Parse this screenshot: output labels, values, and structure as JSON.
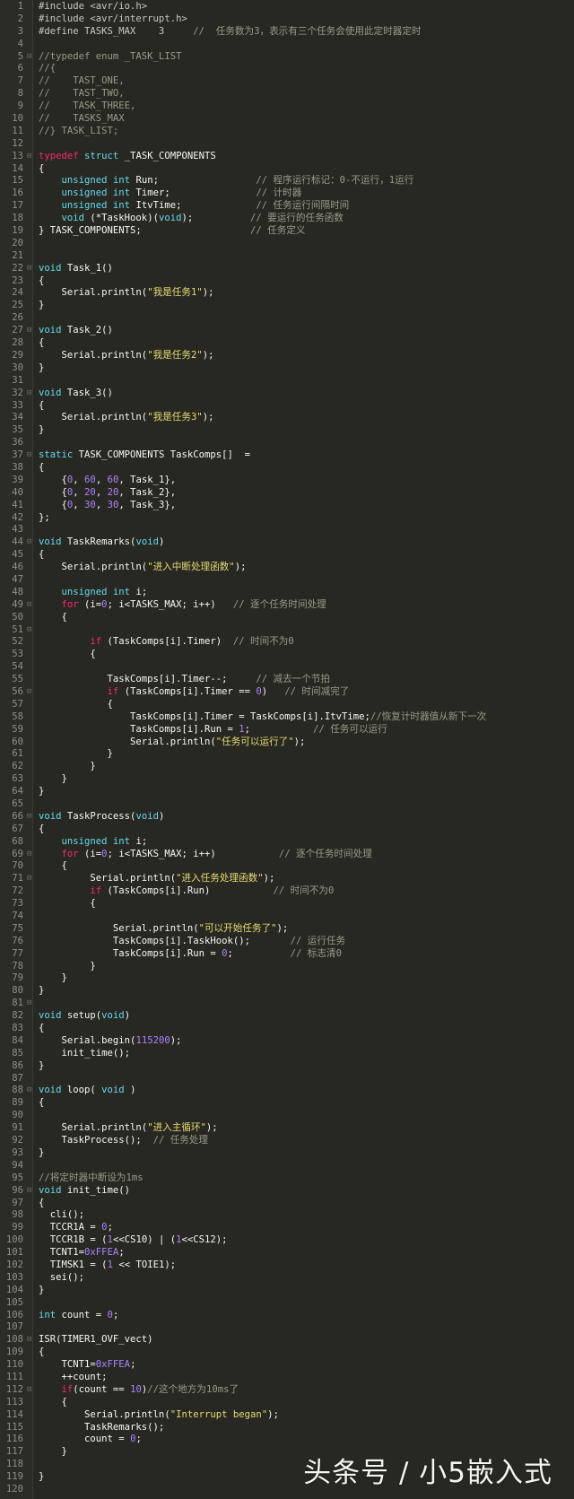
{
  "theme": {
    "background": "#272822",
    "gutter": "#2b2c26",
    "keyword": "#f92672",
    "type": "#66d9ef",
    "string": "#e6db74",
    "number": "#ae81ff",
    "comment": "#9a9a8a"
  },
  "watermark": "头条号 / 小5嵌入式",
  "lines": [
    [
      [
        "pp",
        "#include <avr/io.h>"
      ]
    ],
    [
      [
        "pp",
        "#include <avr/interrupt.h>"
      ]
    ],
    [
      [
        "pp",
        "#define TASKS_MAX    3     "
      ],
      [
        "cm",
        "//  任务数为3，表示有三个任务会使用此定时器定时"
      ]
    ],
    [],
    [
      [
        "cm",
        "//typedef enum _TASK_LIST"
      ]
    ],
    [
      [
        "cm",
        "//{"
      ]
    ],
    [
      [
        "cm",
        "//    TAST_ONE,"
      ]
    ],
    [
      [
        "cm",
        "//    TAST_TWO,"
      ]
    ],
    [
      [
        "cm",
        "//    TASK_THREE,"
      ]
    ],
    [
      [
        "cm",
        "//    TASKS_MAX"
      ]
    ],
    [
      [
        "cm",
        "//} TASK_LIST;"
      ]
    ],
    [],
    [
      [
        "kw",
        "typedef"
      ],
      [
        "plain",
        " "
      ],
      [
        "type",
        "struct"
      ],
      [
        "plain",
        " _TASK_COMPONENTS"
      ]
    ],
    [
      [
        "plain",
        "{"
      ]
    ],
    [
      [
        "plain",
        "    "
      ],
      [
        "type",
        "unsigned int"
      ],
      [
        "plain",
        " Run;                 "
      ],
      [
        "cm",
        "// 程序运行标记：0-不运行，1运行"
      ]
    ],
    [
      [
        "plain",
        "    "
      ],
      [
        "type",
        "unsigned int"
      ],
      [
        "plain",
        " Timer;               "
      ],
      [
        "cm",
        "// 计时器"
      ]
    ],
    [
      [
        "plain",
        "    "
      ],
      [
        "type",
        "unsigned int"
      ],
      [
        "plain",
        " ItvTime;             "
      ],
      [
        "cm",
        "// 任务运行间隔时间"
      ]
    ],
    [
      [
        "plain",
        "    "
      ],
      [
        "type",
        "void"
      ],
      [
        "plain",
        " (*TaskHook)("
      ],
      [
        "type",
        "void"
      ],
      [
        "plain",
        ");          "
      ],
      [
        "cm",
        "// 要运行的任务函数"
      ]
    ],
    [
      [
        "plain",
        "} TASK_COMPONENTS;                   "
      ],
      [
        "cm",
        "// 任务定义"
      ]
    ],
    [],
    [],
    [
      [
        "type",
        "void"
      ],
      [
        "plain",
        " Task_1()"
      ]
    ],
    [
      [
        "plain",
        "{"
      ]
    ],
    [
      [
        "plain",
        "    Serial.println("
      ],
      [
        "str",
        "\"我是任务1\""
      ],
      [
        "plain",
        ");"
      ]
    ],
    [
      [
        "plain",
        "}"
      ]
    ],
    [],
    [
      [
        "type",
        "void"
      ],
      [
        "plain",
        " Task_2()"
      ]
    ],
    [
      [
        "plain",
        "{"
      ]
    ],
    [
      [
        "plain",
        "    Serial.println("
      ],
      [
        "str",
        "\"我是任务2\""
      ],
      [
        "plain",
        ");"
      ]
    ],
    [
      [
        "plain",
        "}"
      ]
    ],
    [],
    [
      [
        "type",
        "void"
      ],
      [
        "plain",
        " Task_3()"
      ]
    ],
    [
      [
        "plain",
        "{"
      ]
    ],
    [
      [
        "plain",
        "    Serial.println("
      ],
      [
        "str",
        "\"我是任务3\""
      ],
      [
        "plain",
        ");"
      ]
    ],
    [
      [
        "plain",
        "}"
      ]
    ],
    [],
    [
      [
        "type",
        "static"
      ],
      [
        "plain",
        " TASK_COMPONENTS TaskComps[]  ="
      ]
    ],
    [
      [
        "plain",
        "{"
      ]
    ],
    [
      [
        "plain",
        "    {"
      ],
      [
        "num",
        "0"
      ],
      [
        "plain",
        ", "
      ],
      [
        "num",
        "60"
      ],
      [
        "plain",
        ", "
      ],
      [
        "num",
        "60"
      ],
      [
        "plain",
        ", Task_1},"
      ]
    ],
    [
      [
        "plain",
        "    {"
      ],
      [
        "num",
        "0"
      ],
      [
        "plain",
        ", "
      ],
      [
        "num",
        "20"
      ],
      [
        "plain",
        ", "
      ],
      [
        "num",
        "20"
      ],
      [
        "plain",
        ", Task_2},"
      ]
    ],
    [
      [
        "plain",
        "    {"
      ],
      [
        "num",
        "0"
      ],
      [
        "plain",
        ", "
      ],
      [
        "num",
        "30"
      ],
      [
        "plain",
        ", "
      ],
      [
        "num",
        "30"
      ],
      [
        "plain",
        ", Task_3},"
      ]
    ],
    [
      [
        "plain",
        "};"
      ]
    ],
    [],
    [
      [
        "type",
        "void"
      ],
      [
        "plain",
        " TaskRemarks("
      ],
      [
        "type",
        "void"
      ],
      [
        "plain",
        ")"
      ]
    ],
    [
      [
        "plain",
        "{"
      ]
    ],
    [
      [
        "plain",
        "    Serial.println("
      ],
      [
        "str",
        "\"进入中断处理函数\""
      ],
      [
        "plain",
        ");"
      ]
    ],
    [],
    [
      [
        "plain",
        "    "
      ],
      [
        "type",
        "unsigned int"
      ],
      [
        "plain",
        " i;"
      ]
    ],
    [
      [
        "plain",
        "    "
      ],
      [
        "kw",
        "for"
      ],
      [
        "plain",
        " (i="
      ],
      [
        "num",
        "0"
      ],
      [
        "plain",
        "; i<TASKS_MAX; i++)   "
      ],
      [
        "cm",
        "// 逐个任务时间处理"
      ]
    ],
    [
      [
        "plain",
        "    {"
      ]
    ],
    [],
    [
      [
        "plain",
        "         "
      ],
      [
        "kw",
        "if"
      ],
      [
        "plain",
        " (TaskComps[i].Timer)  "
      ],
      [
        "cm",
        "// 时间不为0"
      ]
    ],
    [
      [
        "plain",
        "         {"
      ]
    ],
    [],
    [
      [
        "plain",
        "            TaskComps[i].Timer--;     "
      ],
      [
        "cm",
        "// 减去一个节拍"
      ]
    ],
    [
      [
        "plain",
        "            "
      ],
      [
        "kw",
        "if"
      ],
      [
        "plain",
        " (TaskComps[i].Timer == "
      ],
      [
        "num",
        "0"
      ],
      [
        "plain",
        ")   "
      ],
      [
        "cm",
        "// 时间减完了"
      ]
    ],
    [
      [
        "plain",
        "            {"
      ]
    ],
    [
      [
        "plain",
        "                TaskComps[i].Timer = TaskComps[i].ItvTime;"
      ],
      [
        "cm",
        "//恢复计时器值从新下一次"
      ]
    ],
    [
      [
        "plain",
        "                TaskComps[i].Run = "
      ],
      [
        "num",
        "1"
      ],
      [
        "plain",
        ";           "
      ],
      [
        "cm",
        "// 任务可以运行"
      ]
    ],
    [
      [
        "plain",
        "                Serial.println("
      ],
      [
        "str",
        "\"任务可以运行了\""
      ],
      [
        "plain",
        ");"
      ]
    ],
    [
      [
        "plain",
        "            }"
      ]
    ],
    [
      [
        "plain",
        "         }"
      ]
    ],
    [
      [
        "plain",
        "    }"
      ]
    ],
    [
      [
        "plain",
        "}"
      ]
    ],
    [],
    [
      [
        "type",
        "void"
      ],
      [
        "plain",
        " TaskProcess("
      ],
      [
        "type",
        "void"
      ],
      [
        "plain",
        ")"
      ]
    ],
    [
      [
        "plain",
        "{"
      ]
    ],
    [
      [
        "plain",
        "    "
      ],
      [
        "type",
        "unsigned int"
      ],
      [
        "plain",
        " i;"
      ]
    ],
    [
      [
        "plain",
        "    "
      ],
      [
        "kw",
        "for"
      ],
      [
        "plain",
        " (i="
      ],
      [
        "num",
        "0"
      ],
      [
        "plain",
        "; i<TASKS_MAX; i++)           "
      ],
      [
        "cm",
        "// 逐个任务时间处理"
      ]
    ],
    [
      [
        "plain",
        "    {"
      ]
    ],
    [
      [
        "plain",
        "         Serial.println("
      ],
      [
        "str",
        "\"进入任务处理函数\""
      ],
      [
        "plain",
        ");"
      ]
    ],
    [
      [
        "plain",
        "         "
      ],
      [
        "kw",
        "if"
      ],
      [
        "plain",
        " (TaskComps[i].Run)           "
      ],
      [
        "cm",
        "// 时间不为0"
      ]
    ],
    [
      [
        "plain",
        "         {"
      ]
    ],
    [],
    [
      [
        "plain",
        "             Serial.println("
      ],
      [
        "str",
        "\"可以开始任务了\""
      ],
      [
        "plain",
        ");"
      ]
    ],
    [
      [
        "plain",
        "             TaskComps[i].TaskHook();       "
      ],
      [
        "cm",
        "// 运行任务"
      ]
    ],
    [
      [
        "plain",
        "             TaskComps[i].Run = "
      ],
      [
        "num",
        "0"
      ],
      [
        "plain",
        ";          "
      ],
      [
        "cm",
        "// 标志清0"
      ]
    ],
    [
      [
        "plain",
        "         }"
      ]
    ],
    [
      [
        "plain",
        "    }"
      ]
    ],
    [
      [
        "plain",
        "}"
      ]
    ],
    [],
    [
      [
        "type",
        "void"
      ],
      [
        "plain",
        " setup("
      ],
      [
        "type",
        "void"
      ],
      [
        "plain",
        ")"
      ]
    ],
    [
      [
        "plain",
        "{"
      ]
    ],
    [
      [
        "plain",
        "    Serial.begin("
      ],
      [
        "num",
        "115200"
      ],
      [
        "plain",
        ");"
      ]
    ],
    [
      [
        "plain",
        "    init_time();"
      ]
    ],
    [
      [
        "plain",
        "}"
      ]
    ],
    [],
    [
      [
        "type",
        "void"
      ],
      [
        "plain",
        " loop( "
      ],
      [
        "type",
        "void"
      ],
      [
        "plain",
        " )"
      ]
    ],
    [
      [
        "plain",
        "{"
      ]
    ],
    [],
    [
      [
        "plain",
        "    Serial.println("
      ],
      [
        "str",
        "\"进入主循环\""
      ],
      [
        "plain",
        ");"
      ]
    ],
    [
      [
        "plain",
        "    TaskProcess();  "
      ],
      [
        "cm",
        "// 任务处理"
      ]
    ],
    [
      [
        "plain",
        "}"
      ]
    ],
    [],
    [
      [
        "cm",
        "//将定时器中断设为1ms"
      ]
    ],
    [
      [
        "type",
        "void"
      ],
      [
        "plain",
        " init_time()"
      ]
    ],
    [
      [
        "plain",
        "{"
      ]
    ],
    [
      [
        "plain",
        "  cli();"
      ]
    ],
    [
      [
        "plain",
        "  TCCR1A = "
      ],
      [
        "num",
        "0"
      ],
      [
        "plain",
        ";"
      ]
    ],
    [
      [
        "plain",
        "  TCCR1B = ("
      ],
      [
        "num",
        "1"
      ],
      [
        "plain",
        "<<CS10) | ("
      ],
      [
        "num",
        "1"
      ],
      [
        "plain",
        "<<CS12);"
      ]
    ],
    [
      [
        "plain",
        "  TCNT1="
      ],
      [
        "num",
        "0xFFEA"
      ],
      [
        "plain",
        ";"
      ]
    ],
    [
      [
        "plain",
        "  TIMSK1 = ("
      ],
      [
        "num",
        "1"
      ],
      [
        "plain",
        " << TOIE1);"
      ]
    ],
    [
      [
        "plain",
        "  sei();"
      ]
    ],
    [
      [
        "plain",
        "}"
      ]
    ],
    [],
    [
      [
        "type",
        "int"
      ],
      [
        "plain",
        " count = "
      ],
      [
        "num",
        "0"
      ],
      [
        "plain",
        ";"
      ]
    ],
    [],
    [
      [
        "plain",
        "ISR(TIMER1_OVF_vect)"
      ]
    ],
    [
      [
        "plain",
        "{"
      ]
    ],
    [
      [
        "plain",
        "    TCNT1="
      ],
      [
        "num",
        "0xFFEA"
      ],
      [
        "plain",
        ";"
      ]
    ],
    [
      [
        "plain",
        "    ++count;"
      ]
    ],
    [
      [
        "plain",
        "    "
      ],
      [
        "kw",
        "if"
      ],
      [
        "plain",
        "(count == "
      ],
      [
        "num",
        "10"
      ],
      [
        "plain",
        ")"
      ],
      [
        "cm",
        "//这个地方为10ms了"
      ]
    ],
    [
      [
        "plain",
        "    {"
      ]
    ],
    [
      [
        "plain",
        "        Serial.println("
      ],
      [
        "str",
        "\"Interrupt began\""
      ],
      [
        "plain",
        ");"
      ]
    ],
    [
      [
        "plain",
        "        TaskRemarks();"
      ]
    ],
    [
      [
        "plain",
        "        count = "
      ],
      [
        "num",
        "0"
      ],
      [
        "plain",
        ";"
      ]
    ],
    [
      [
        "plain",
        "    }"
      ]
    ],
    [],
    [
      [
        "plain",
        "}"
      ]
    ],
    []
  ]
}
